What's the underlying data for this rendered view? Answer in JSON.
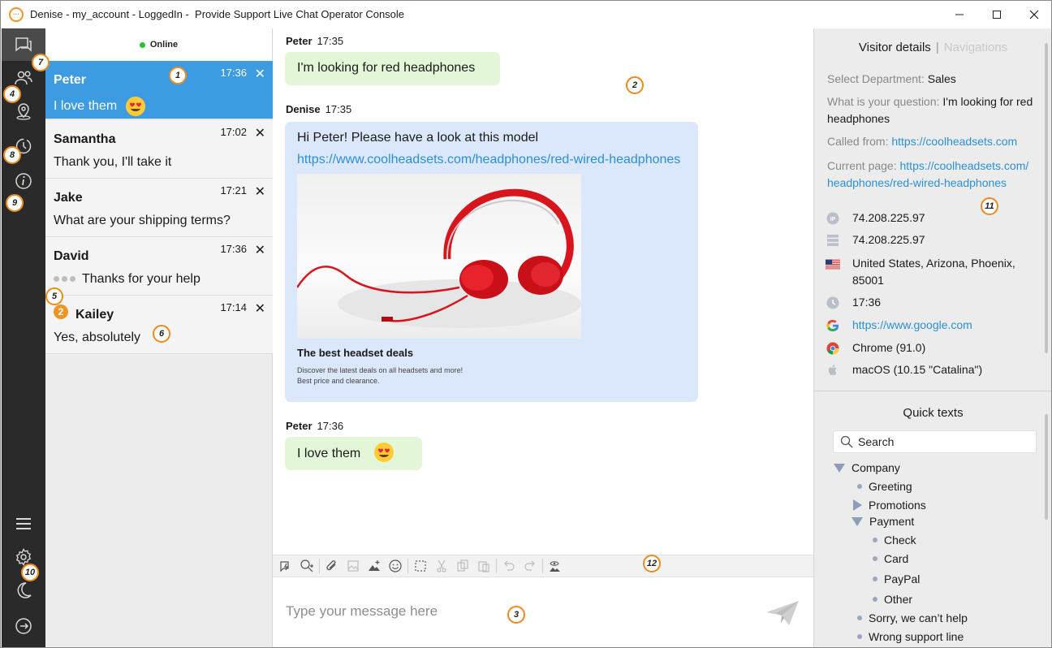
{
  "window": {
    "title": "Denise - my_account - LoggedIn -  Provide Support Live Chat Operator Console"
  },
  "markers": [
    "1",
    "2",
    "3",
    "4",
    "5",
    "6",
    "7",
    "8",
    "9",
    "10",
    "11",
    "12"
  ],
  "chat_list": {
    "status": "Online",
    "items": [
      {
        "name": "Peter",
        "message": "I love them",
        "time": "17:36",
        "close": "✕"
      },
      {
        "name": "Samantha",
        "message": "Thank you, I'll take it",
        "time": "17:02",
        "close": "✕"
      },
      {
        "name": "Jake",
        "message": "What are your shipping terms?",
        "time": "17:21",
        "close": "✕"
      },
      {
        "name": "David",
        "message": "Thanks for your help",
        "time": "17:36",
        "close": "✕"
      },
      {
        "name": "Kailey",
        "message": "Yes, absolutely",
        "time": "17:14",
        "close": "✕",
        "unread": "2"
      }
    ]
  },
  "conversation": {
    "messages": [
      {
        "author": "Peter",
        "time": "17:35",
        "text": "I'm looking for red headphones"
      },
      {
        "author": "Denise",
        "time": "17:35",
        "text": "Hi Peter! Please have a look at this model",
        "link": "https://www.coolheadsets.com/headphones/red-wired-headphones",
        "card_title": "The best headset deals",
        "card_desc": "Discover the latest deals on all headsets and more!\nBest price and clearance."
      },
      {
        "author": "Peter",
        "time": "17:36",
        "text": "I love them"
      }
    ]
  },
  "composer": {
    "placeholder": "Type your message here"
  },
  "visitor_details": {
    "tab_active": "Visitor details",
    "tab_separator": "|",
    "tab_inactive": "Navigations",
    "department_label": "Select Department:",
    "department_value": "Sales",
    "question_label": "What is your question:",
    "question_value": "I'm looking for red headphones",
    "called_from_label": "Called from:",
    "called_from_value": "https://coolheadsets.com",
    "current_page_label": "Current page:",
    "current_page_value": "https://coolheadsets.com/ headphones/red-wired-headphones",
    "ip": "74.208.225.97",
    "host": "74.208.225.97",
    "location": "United States, Arizona, Phoenix, 85001",
    "local_time": "17:36",
    "referrer": "https://www.google.com",
    "browser": "Chrome (91.0)",
    "os": "macOS (10.15 \"Catalina\")"
  },
  "quick_texts": {
    "title": "Quick texts",
    "search_placeholder": "Search",
    "tree": {
      "company": "Company",
      "greeting": "Greeting",
      "promotions": "Promotions",
      "payment": "Payment",
      "check": "Check",
      "card": "Card",
      "paypal": "PayPal",
      "other": "Other",
      "sorry": "Sorry, we can’t help",
      "wrong": "Wrong support line"
    }
  }
}
